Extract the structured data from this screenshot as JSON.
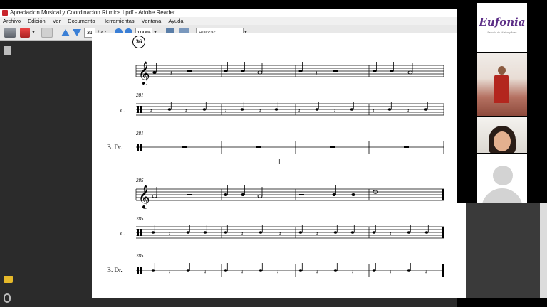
{
  "window": {
    "title": "Apreciacion Musical y Coordinacion Ritmica I.pdf - Adobe Reader"
  },
  "menu": [
    "Archivo",
    "Edición",
    "Ver",
    "Documento",
    "Herramientas",
    "Ventana",
    "Ayuda"
  ],
  "toolbar": {
    "current_page": "31",
    "page_count": "/ 47",
    "zoom": "100%",
    "search_placeholder": "Buscar"
  },
  "score": {
    "rehearsal_mark": "36",
    "system1": {
      "measure_markers": [
        "281",
        "281"
      ],
      "staff_labels": [
        "c.",
        "B. Dr."
      ]
    },
    "system2": {
      "measure_markers": [
        "285",
        "285",
        "285"
      ],
      "staff_labels": [
        "c.",
        "B. Dr."
      ]
    }
  },
  "video": {
    "logo_text": "Eufonia",
    "logo_subtext": "Escuela de Música y Artes"
  },
  "colors": {
    "reader_background": "#2b2b2b",
    "logo_purple": "#5b2d86",
    "nav_arrow_blue": "#3a7fd6"
  }
}
